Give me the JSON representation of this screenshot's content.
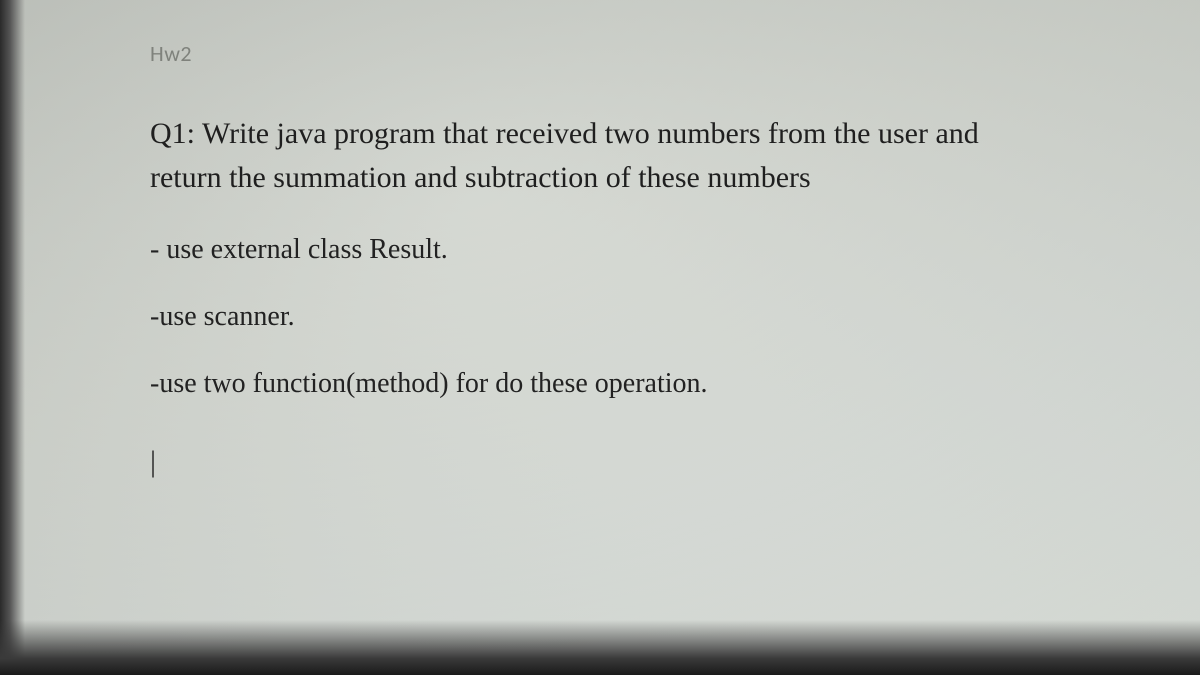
{
  "header": {
    "label": "Hw2"
  },
  "content": {
    "question": "Q1: Write java program that received two numbers from the user and return the summation and subtraction of these numbers",
    "bullets": [
      "- use external class Result.",
      "-use scanner.",
      "-use two function(method) for do these operation."
    ],
    "cursor": "|"
  }
}
